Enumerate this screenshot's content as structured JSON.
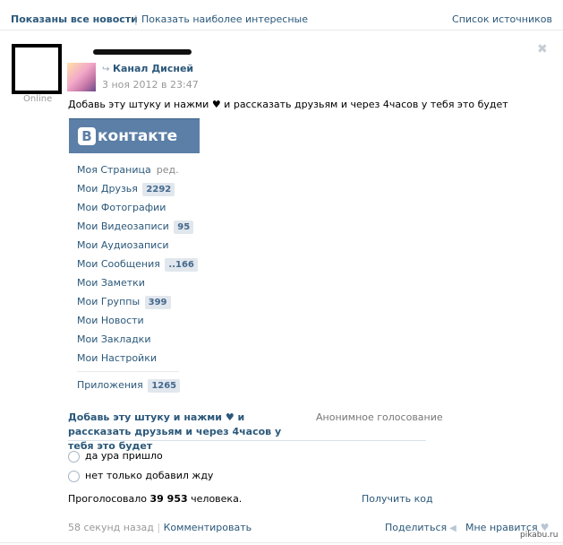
{
  "filters": {
    "all_news": "Показаны все новости",
    "separator": "|",
    "interesting": "Показать наиболее интересные",
    "sources": "Список источников"
  },
  "post": {
    "online": "Online",
    "close": "✖",
    "channel": "Канал Дисней",
    "date": "3 ноя 2012 в 23:47",
    "text": "Добавь эту штуку и нажми ♥ и рассказать друзьям и через 4часов у тебя это будет",
    "image": {
      "logo_letter": "В",
      "logo_word": "контакте",
      "menu": [
        {
          "label": "Моя Страница",
          "extra": "ред."
        },
        {
          "label": "Мои Друзья",
          "count": "2292"
        },
        {
          "label": "Мои Фотографии"
        },
        {
          "label": "Мои Видеозаписи",
          "count": "95"
        },
        {
          "label": "Мои Аудиозаписи"
        },
        {
          "label": "Мои Сообщения",
          "count": "..166"
        },
        {
          "label": "Мои Заметки"
        },
        {
          "label": "Мои Группы",
          "count": "399"
        },
        {
          "label": "Мои Новости"
        },
        {
          "label": "Мои Закладки"
        },
        {
          "label": "Мои Настройки"
        }
      ],
      "apps": {
        "label": "Приложения",
        "count": "1265"
      }
    },
    "poll": {
      "question": "Добавь эту штуку и нажми ♥ и рассказать друзьям и через 4часов у тебя это будет",
      "type": "Анонимное голосование",
      "options": [
        "да ура пришло",
        "нет только добавил жду"
      ],
      "votes_prefix": "Проголосовало",
      "votes_count": "39 953",
      "votes_suffix": "человека.",
      "get_code": "Получить код"
    },
    "footer": {
      "time_ago": "58 секунд назад",
      "separator": "|",
      "comment": "Комментировать",
      "share": "Поделиться",
      "like": "Мне нравится"
    }
  },
  "watermark": "pikabu.ru"
}
